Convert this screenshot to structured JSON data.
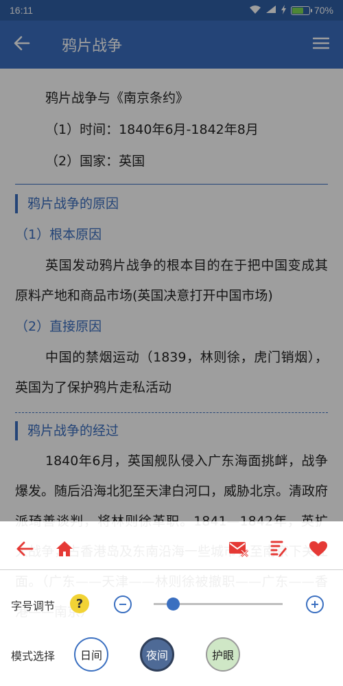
{
  "status": {
    "time": "16:11",
    "battery": "70%",
    "battery_level": 0.7
  },
  "toolbar": {
    "title": "鸦片战争"
  },
  "content": {
    "intro": [
      "鸦片战争与《南京条约》",
      "（1）时间：1840年6月-1842年8月",
      "（2）国家：英国"
    ],
    "section1": {
      "title": "鸦片战争的原因",
      "sub1": "（1）根本原因",
      "para1": "英国发动鸦片战争的根本目的在于把中国变成其原料产地和商品市场(英国决意打开中国市场)",
      "sub2": "（2）直接原因",
      "para2": "中国的禁烟运动（1839，林则徐，虎门销烟），英国为了保护鸦片走私活动"
    },
    "section2": {
      "title": "鸦片战争的经过",
      "para": "1840年6月，英国舰队侵入广东海面挑衅，战争爆发。随后沿海北犯至天津白河口，威胁北京。清政府派琦善谈判，将林则徐革职。1841—1842年，英扩大战争，占香港岛及东南沿海一些城市，至南京下关江面。（广东——天津——林则徐被撤职——广东——香港——南京）"
    }
  },
  "panel": {
    "font_label": "字号调节",
    "help": "?",
    "font_level": 0.15,
    "mode_label": "模式选择",
    "modes": {
      "day": "日间",
      "night": "夜间",
      "eye": "护眼"
    },
    "colors": {
      "accent": "#3a6fc0",
      "icon_red": "#e53935"
    }
  }
}
